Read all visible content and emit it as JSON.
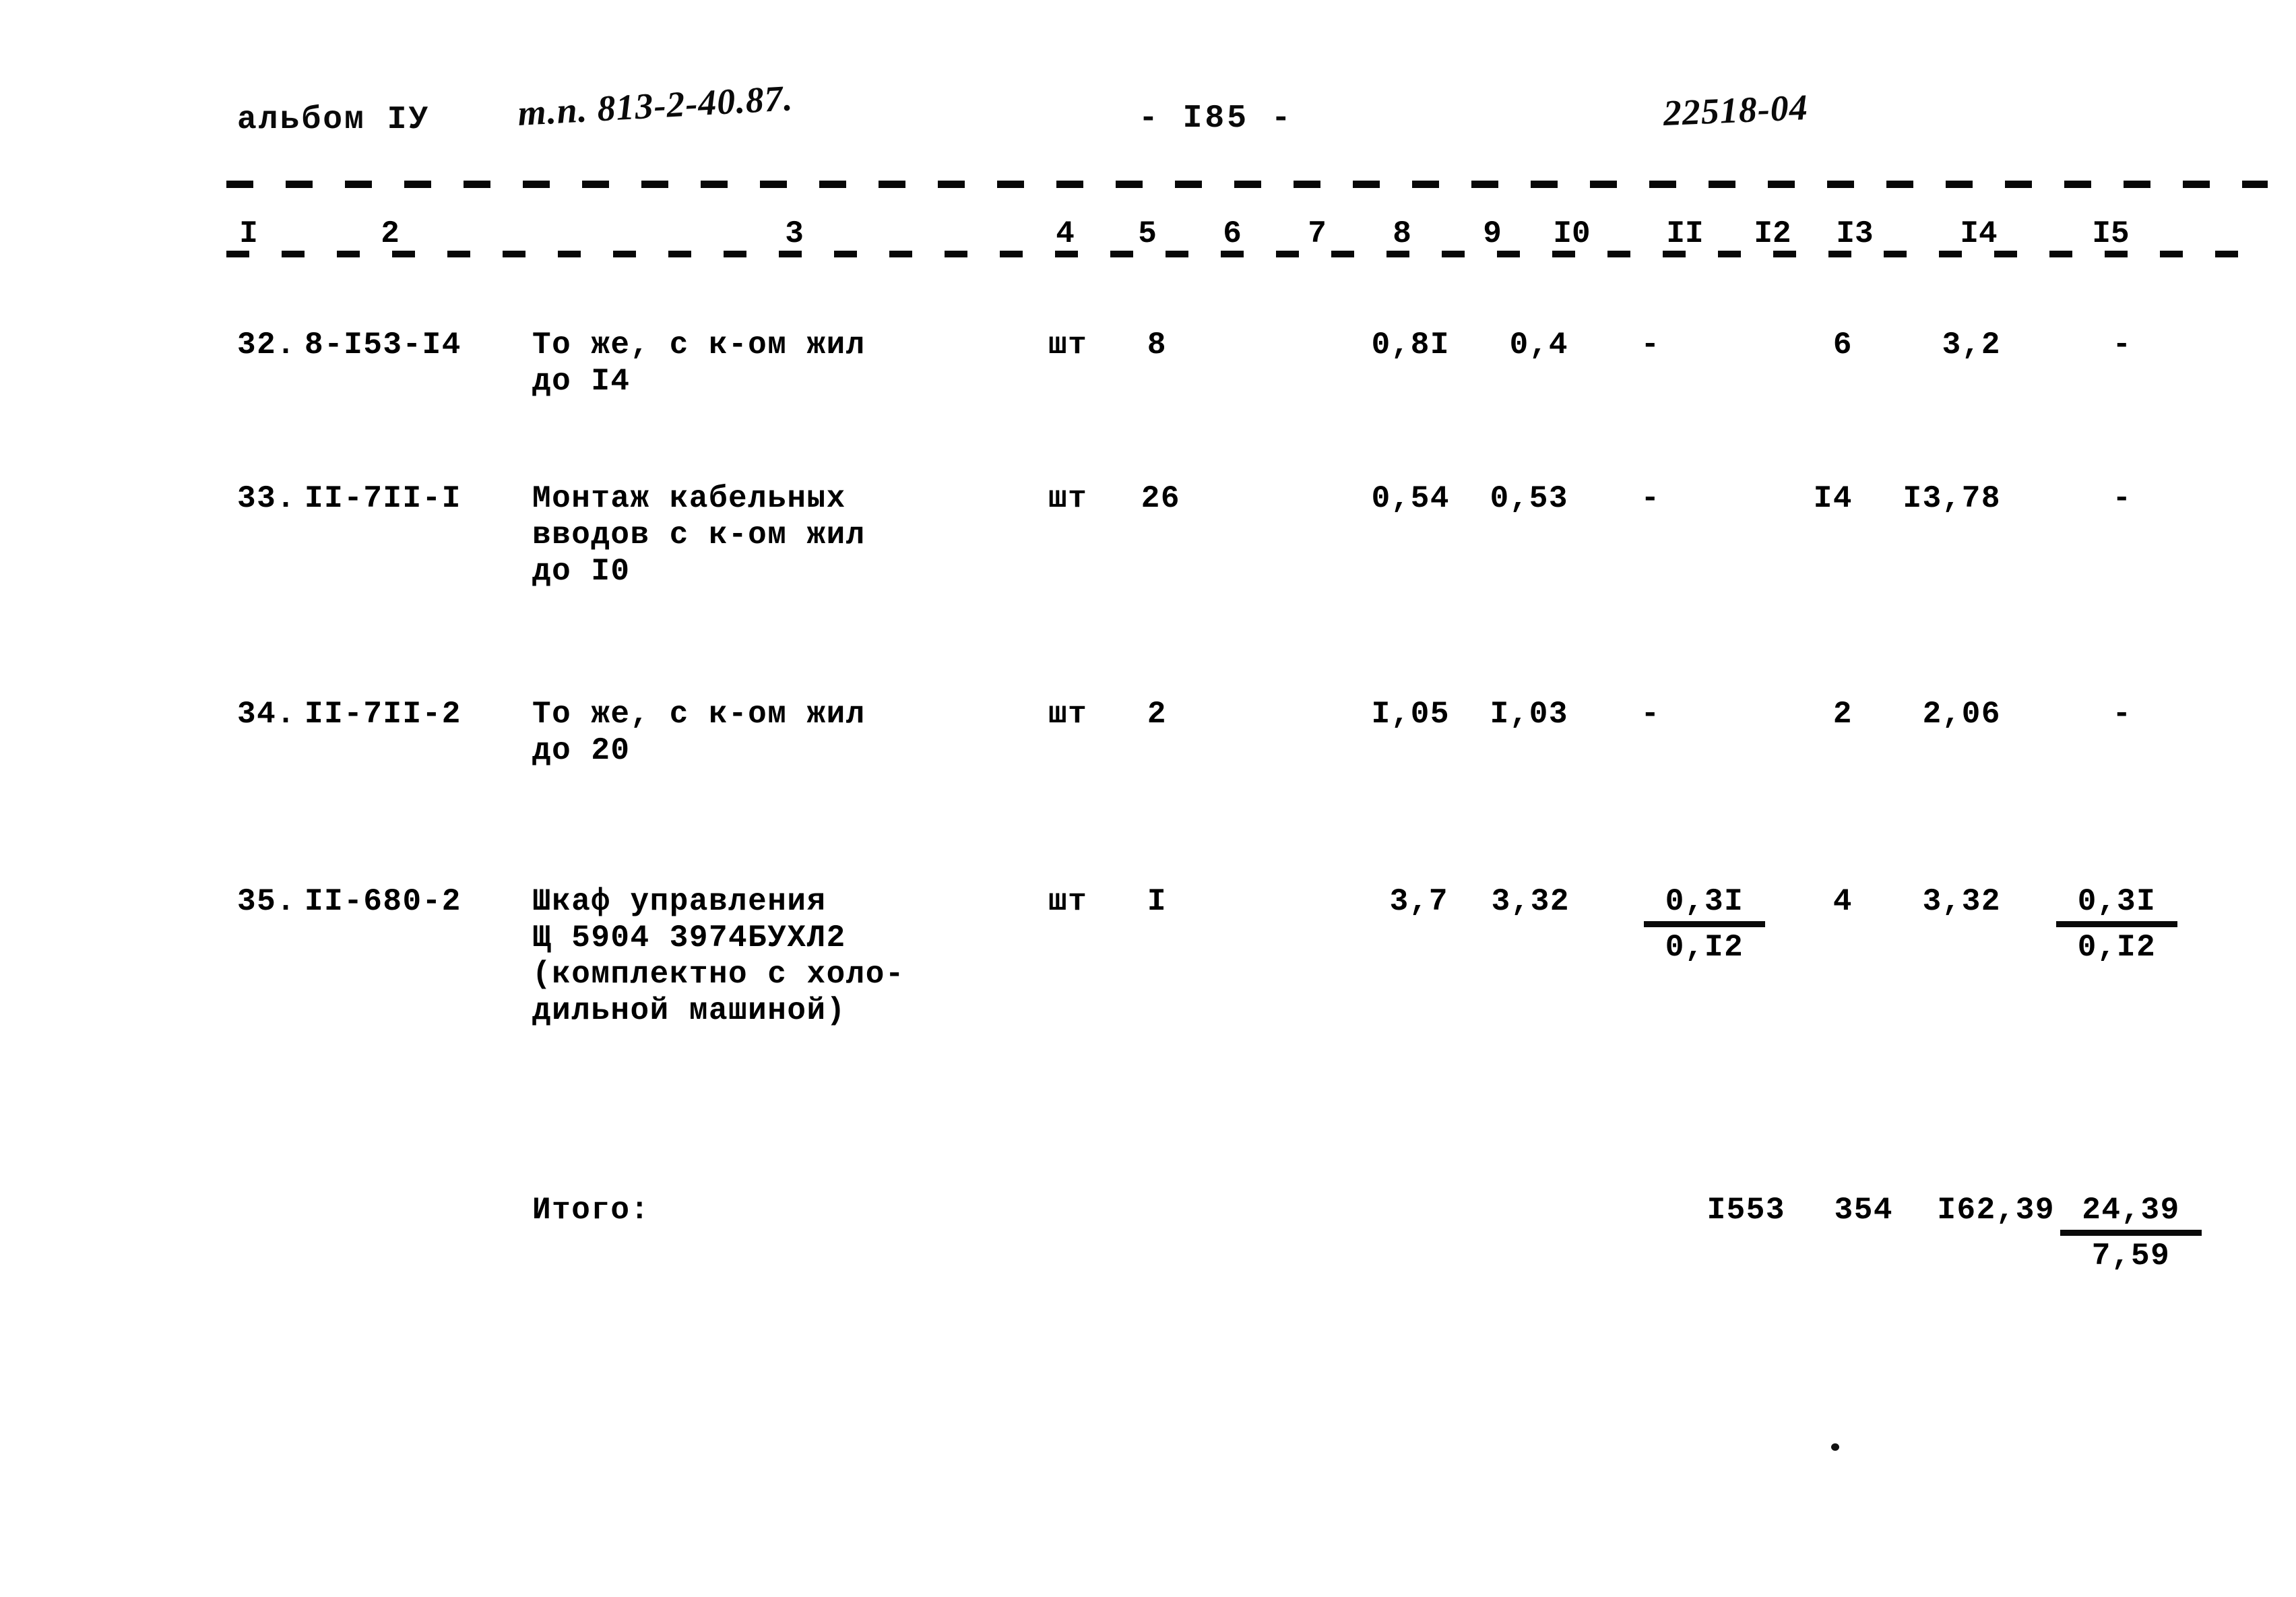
{
  "header": {
    "album": "альбом IУ",
    "project_code": "т.п. 813-2-40.87.",
    "page_number": "- I85 -",
    "doc_code": "22518-04"
  },
  "column_numbers": [
    "I",
    "2",
    "3",
    "4",
    "5",
    "6",
    "7",
    "8",
    "9",
    "I0",
    "II",
    "I2",
    "I3",
    "I4",
    "I5"
  ],
  "rows": [
    {
      "no": "32.",
      "code": "8-I53-I4",
      "name_lines": [
        "То же, с к-ом жил",
        "до I4"
      ],
      "unit": "шт",
      "qty": "8",
      "c8": "0,8I",
      "c9": "0,4",
      "c10": "-",
      "c11": "",
      "c12": "",
      "c13": "6",
      "c14": "3,2",
      "c15": "-"
    },
    {
      "no": "33.",
      "code": "II-7II-I",
      "name_lines": [
        "Монтаж кабельных",
        "вводов с к-ом жил",
        "до I0"
      ],
      "unit": "шт",
      "qty": "26",
      "c8": "0,54",
      "c9": "0,53",
      "c10": "-",
      "c11": "",
      "c12": "",
      "c13": "I4",
      "c14": "I3,78",
      "c15": "-"
    },
    {
      "no": "34.",
      "code": "II-7II-2",
      "name_lines": [
        "То же, с к-ом жил",
        "до 20"
      ],
      "unit": "шт",
      "qty": "2",
      "c8": "I,05",
      "c9": "I,03",
      "c10": "-",
      "c11": "",
      "c12": "",
      "c13": "2",
      "c14": "2,06",
      "c15": "-"
    },
    {
      "no": "35.",
      "code": "II-680-2",
      "name_lines": [
        "Шкаф управления",
        "Щ 5904 3974БУХЛ2",
        "(комплектно с холо-",
        "дильной машиной)"
      ],
      "unit": "шт",
      "qty": "I",
      "c8": "3,7",
      "c9": "3,32",
      "c10_top": "0,3I",
      "c10_bot": "0,I2",
      "c13": "4",
      "c14": "3,32",
      "c15_top": "0,3I",
      "c15_bot": "0,I2"
    }
  ],
  "total": {
    "label": "Итого:",
    "c11": "I553",
    "c12": "354",
    "c13": "I62,39",
    "c15_top": "24,39",
    "c15_bot": "7,59"
  }
}
